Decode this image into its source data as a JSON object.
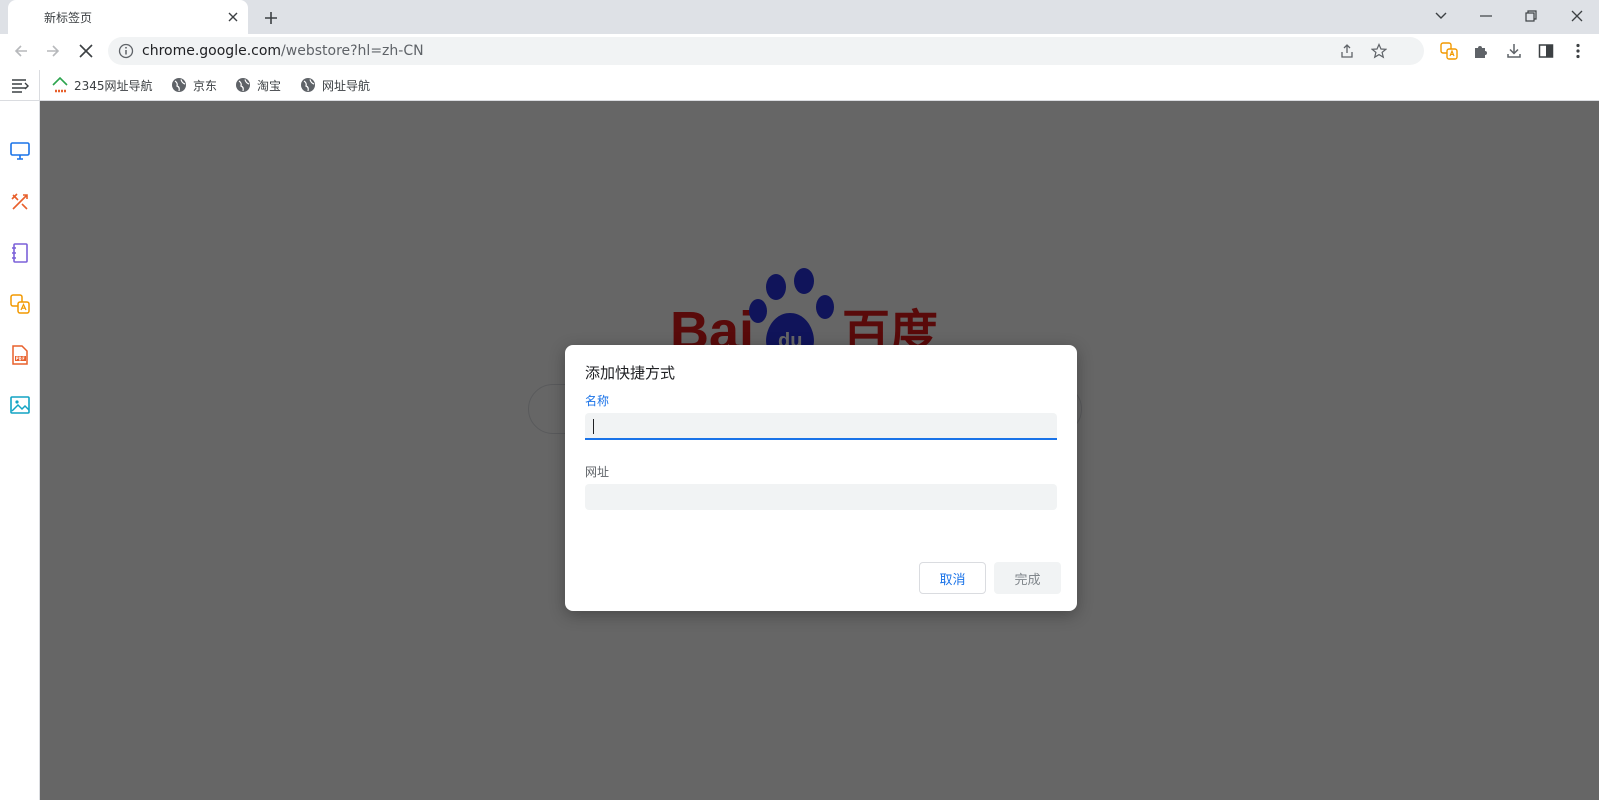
{
  "tab": {
    "title": "新标签页"
  },
  "omnibox": {
    "url_host": "chrome.google.com",
    "url_path": "/webstore?hl=zh-CN"
  },
  "bookmarks": [
    {
      "label": "2345网址导航",
      "icon": "2345-logo-icon"
    },
    {
      "label": "京东",
      "icon": "globe-icon"
    },
    {
      "label": "淘宝",
      "icon": "globe-icon"
    },
    {
      "label": "网址导航",
      "icon": "globe-icon"
    }
  ],
  "side_panel": [
    {
      "icon": "monitor-icon",
      "color": "#1a73e8"
    },
    {
      "icon": "tools-icon",
      "color": "#e8602c"
    },
    {
      "icon": "notebook-icon",
      "color": "#7b61d9"
    },
    {
      "icon": "translate-icon",
      "color": "#f29900"
    },
    {
      "icon": "pdf-icon",
      "color": "#e8602c"
    },
    {
      "icon": "image-icon",
      "color": "#12a4c4"
    }
  ],
  "dialog": {
    "title": "添加快捷方式",
    "name_label": "名称",
    "name_value": "",
    "url_label": "网址",
    "url_value": "",
    "cancel_label": "取消",
    "done_label": "完成"
  },
  "colors": {
    "accent": "#1a73e8",
    "baidu_red": "#de1a1a",
    "baidu_blue": "#2932e1"
  }
}
